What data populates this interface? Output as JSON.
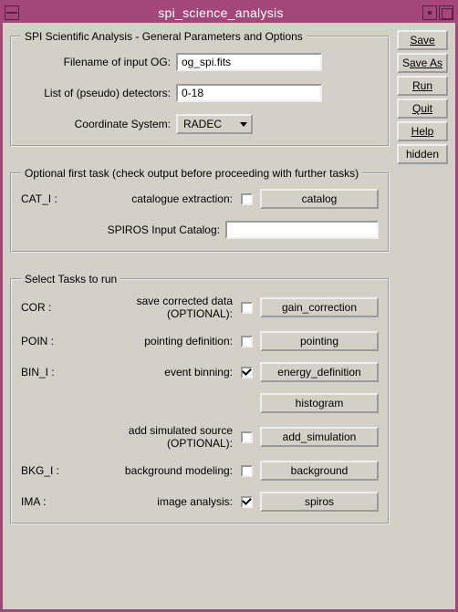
{
  "window": {
    "title": "spi_science_analysis"
  },
  "sidebar": {
    "save": "Save",
    "save_as_pre": "S",
    "save_as_post": "ave As",
    "run": "Run",
    "quit": "Quit",
    "help": "Help",
    "hidden": "hidden"
  },
  "group1": {
    "legend": "SPI Scientific Analysis - General Parameters and Options",
    "filename_label": "Filename of input OG:",
    "filename_value": "og_spi.fits",
    "detectors_label": "List of (pseudo) detectors:",
    "detectors_value": "0-18",
    "coord_label": "Coordinate System:",
    "coord_value": "RADEC"
  },
  "group2": {
    "legend": "Optional first task (check output before proceeding with further tasks)",
    "cat_prefix": "CAT_I :",
    "cat_label": "catalogue extraction:",
    "cat_button": "catalog",
    "spiros_label": "SPIROS Input Catalog:",
    "spiros_value": ""
  },
  "group3": {
    "legend": "Select Tasks to run",
    "tasks": [
      {
        "prefix": "COR :",
        "label": "save corrected data (OPTIONAL):",
        "checked": false,
        "button": "gain_correction"
      },
      {
        "prefix": "POIN :",
        "label": "pointing definition:",
        "checked": false,
        "button": "pointing"
      },
      {
        "prefix": "BIN_I :",
        "label": "event binning:",
        "checked": true,
        "button": "energy_definition"
      },
      {
        "prefix": "",
        "label": "",
        "checked": null,
        "button": "histogram"
      },
      {
        "prefix": "",
        "label": "add simulated source (OPTIONAL):",
        "checked": false,
        "button": "add_simulation"
      },
      {
        "prefix": "BKG_I :",
        "label": "background modeling:",
        "checked": false,
        "button": "background"
      },
      {
        "prefix": "IMA :",
        "label": "image analysis:",
        "checked": true,
        "button": "spiros"
      }
    ]
  }
}
